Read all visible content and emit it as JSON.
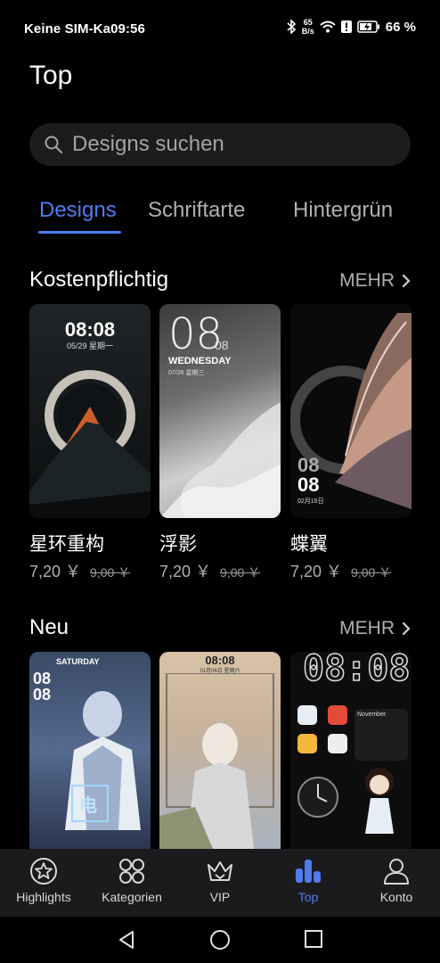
{
  "status_bar": {
    "carrier": "Keine SIM-Ka",
    "time": "09:56",
    "net_speed_value": "65",
    "net_speed_unit": "B/s",
    "battery": "66 %"
  },
  "page": {
    "title": "Top"
  },
  "search": {
    "placeholder": "Designs suchen"
  },
  "tabs": [
    {
      "label": "Designs",
      "active": true
    },
    {
      "label": "Schriftarte",
      "active": false
    },
    {
      "label": "Hintergrün",
      "active": false
    }
  ],
  "sections": [
    {
      "title": "Kostenpflichtig",
      "more": "MEHR",
      "items": [
        {
          "name": "星环重构",
          "price": "7,20 ￥",
          "old_price": "9,00 ￥",
          "preview_time": "08:08",
          "preview_date": "05/29 星期一"
        },
        {
          "name": "浮影",
          "price": "7,20 ￥",
          "old_price": "9,00 ￥",
          "preview_time": "08",
          "preview_time_small": "08",
          "preview_day": "WEDNESDAY",
          "preview_date": "07/26 星期三"
        },
        {
          "name": "蝶翼",
          "price": "7,20 ￥",
          "old_price": "9,00 ￥",
          "preview_time": "08",
          "preview_time2": "08",
          "preview_date": "02月16日"
        }
      ]
    },
    {
      "title": "Neu",
      "more": "MEHR",
      "items": [
        {
          "preview_day": "SATURDAY",
          "preview_time": "08",
          "preview_time2": "08",
          "preview_badge": "电"
        },
        {
          "preview_time": "08:08",
          "preview_date": "01月06日 星期六"
        },
        {
          "preview_time": "08:08",
          "preview_month": "November"
        }
      ]
    }
  ],
  "bottom_nav": [
    {
      "label": "Highlights",
      "icon": "star-badge-icon",
      "active": false
    },
    {
      "label": "Kategorien",
      "icon": "grid-icon",
      "active": false
    },
    {
      "label": "VIP",
      "icon": "crown-icon",
      "active": false
    },
    {
      "label": "Top",
      "icon": "bar-chart-icon",
      "active": true
    },
    {
      "label": "Konto",
      "icon": "person-icon",
      "active": false
    }
  ],
  "colors": {
    "accent": "#4f7df0",
    "background": "#000000",
    "navbar": "#1b1b1d"
  }
}
